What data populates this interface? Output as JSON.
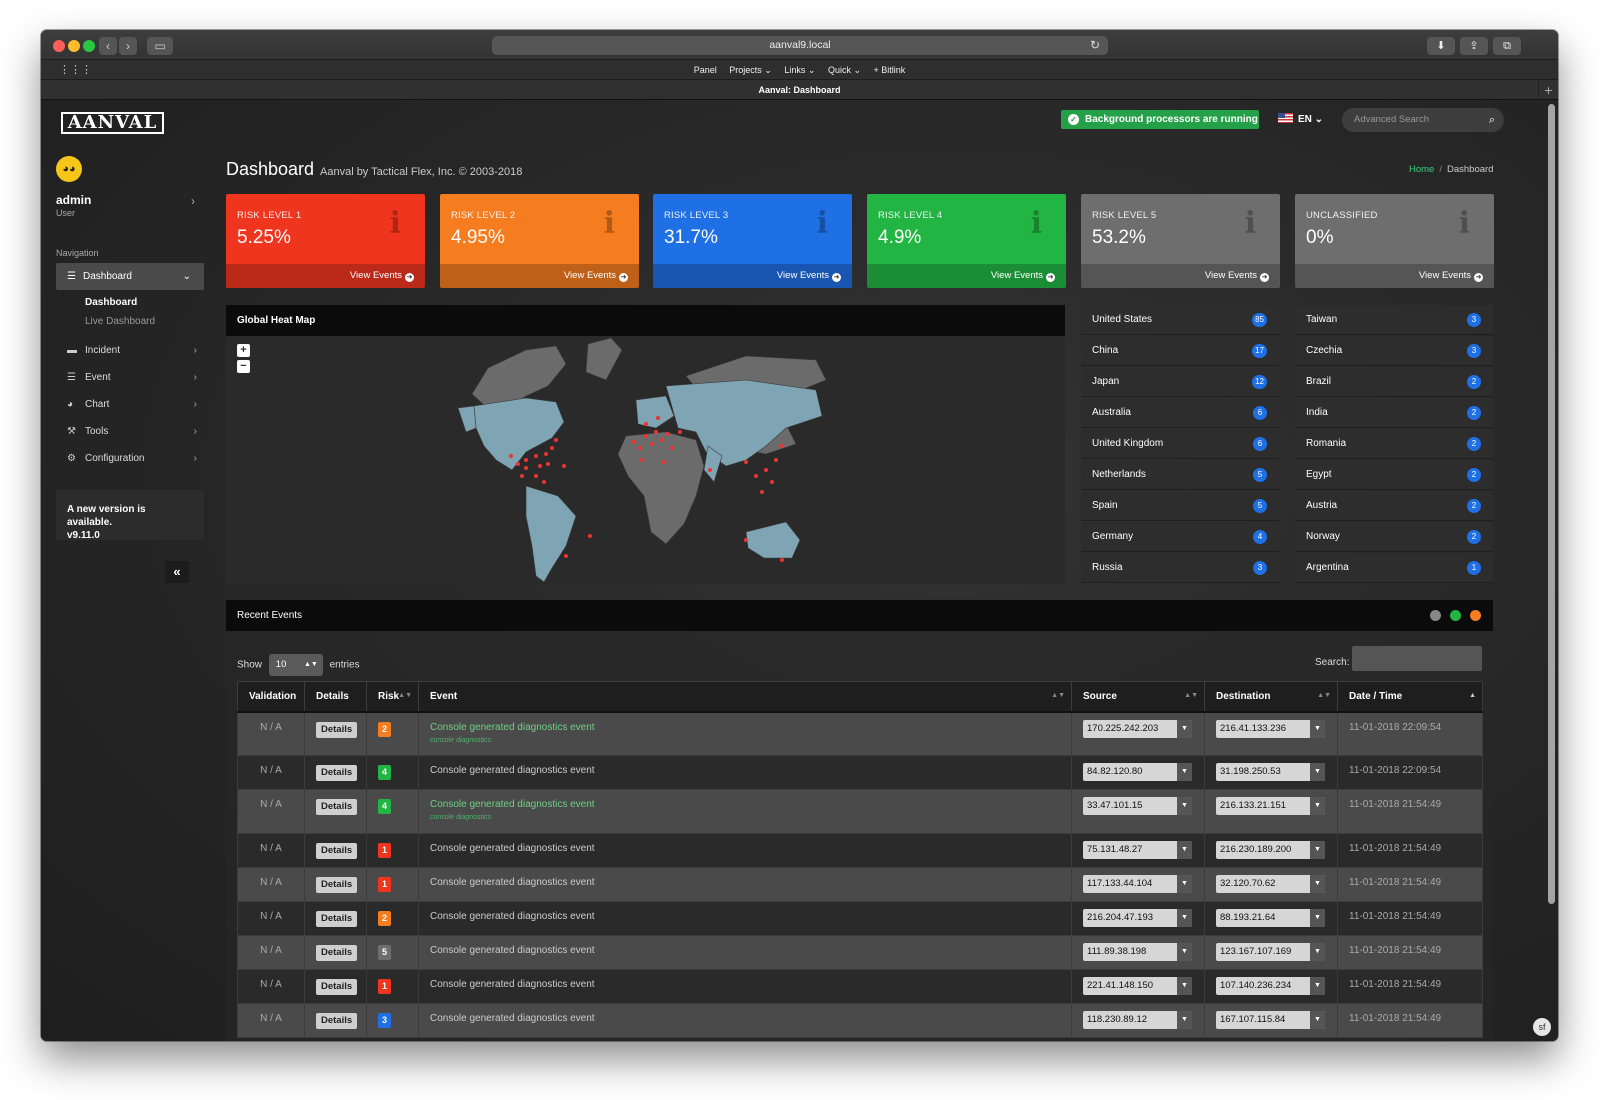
{
  "browser": {
    "url": "aanval9.local",
    "tab_title": "Aanval: Dashboard",
    "favorites": [
      "Panel",
      "Projects ⌄",
      "Links ⌄",
      "Quick ⌄",
      "+ Bitlink"
    ]
  },
  "brand": {
    "logo_text": "AANVAL"
  },
  "user": {
    "name": "admin",
    "role": "User"
  },
  "nav": {
    "label": "Navigation",
    "active": "Dashboard",
    "sub_items": [
      "Dashboard",
      "Live Dashboard"
    ],
    "items": [
      {
        "label": "Incident",
        "icon": "folder-icon"
      },
      {
        "label": "Event",
        "icon": "list-icon"
      },
      {
        "label": "Chart",
        "icon": "pie-chart-icon"
      },
      {
        "label": "Tools",
        "icon": "wrench-icon"
      },
      {
        "label": "Configuration",
        "icon": "cogs-icon"
      }
    ]
  },
  "version_notice": {
    "line1": "A new version is available.",
    "line2": "v9.11.0"
  },
  "topbar": {
    "status": "Background processors are running",
    "language": "EN",
    "search_placeholder": "Advanced Search"
  },
  "page": {
    "title": "Dashboard",
    "subtitle": "Aanval by Tactical Flex, Inc. © 2003-2018",
    "breadcrumb_home": "Home",
    "breadcrumb_current": "Dashboard"
  },
  "risk_cards": [
    {
      "label": "RISK LEVEL 1",
      "value": "5.25%",
      "color": "#f0351f",
      "link": "View Events"
    },
    {
      "label": "RISK LEVEL 2",
      "value": "4.95%",
      "color": "#f57c1f",
      "link": "View Events"
    },
    {
      "label": "RISK LEVEL 3",
      "value": "31.7%",
      "color": "#1f6fe5",
      "link": "View Events"
    },
    {
      "label": "RISK LEVEL 4",
      "value": "4.9%",
      "color": "#23b543",
      "link": "View Events"
    },
    {
      "label": "RISK LEVEL 5",
      "value": "53.2%",
      "color": "#6e6e6e",
      "link": "View Events"
    },
    {
      "label": "UNCLASSIFIED",
      "value": "0%",
      "color": "#6e6e6e",
      "link": "View Events"
    }
  ],
  "heatmap": {
    "title": "Global Heat Map"
  },
  "countries_left": [
    {
      "name": "United States",
      "count": "85"
    },
    {
      "name": "China",
      "count": "17"
    },
    {
      "name": "Japan",
      "count": "12"
    },
    {
      "name": "Australia",
      "count": "6"
    },
    {
      "name": "United Kingdom",
      "count": "6"
    },
    {
      "name": "Netherlands",
      "count": "5"
    },
    {
      "name": "Spain",
      "count": "5"
    },
    {
      "name": "Germany",
      "count": "4"
    },
    {
      "name": "Russia",
      "count": "3"
    }
  ],
  "countries_right": [
    {
      "name": "Taiwan",
      "count": "3"
    },
    {
      "name": "Czechia",
      "count": "3"
    },
    {
      "name": "Brazil",
      "count": "2"
    },
    {
      "name": "India",
      "count": "2"
    },
    {
      "name": "Romania",
      "count": "2"
    },
    {
      "name": "Egypt",
      "count": "2"
    },
    {
      "name": "Austria",
      "count": "2"
    },
    {
      "name": "Norway",
      "count": "2"
    },
    {
      "name": "Argentina",
      "count": "1"
    }
  ],
  "events": {
    "title": "Recent Events",
    "show_label": "Show",
    "entries_value": "10",
    "entries_label": "entries",
    "search_label": "Search:",
    "columns": [
      "Validation",
      "Details",
      "Risk",
      "Event",
      "Source",
      "Destination",
      "Date / Time"
    ],
    "details_label": "Details",
    "rows": [
      {
        "validation": "N / A",
        "risk": "2",
        "risk_color": "#f57c1f",
        "event": "Console generated diagnostics event",
        "sub": "console diagnostics",
        "source": "170.225.242.203",
        "dest": "216.41.133.236",
        "datetime": "11-01-2018 22:09:54"
      },
      {
        "validation": "N / A",
        "risk": "4",
        "risk_color": "#23b543",
        "event": "Console generated diagnostics event",
        "sub": "",
        "source": "84.82.120.80",
        "dest": "31.198.250.53",
        "datetime": "11-01-2018 22:09:54"
      },
      {
        "validation": "N / A",
        "risk": "4",
        "risk_color": "#23b543",
        "event": "Console generated diagnostics event",
        "sub": "console diagnostics",
        "source": "33.47.101.15",
        "dest": "216.133.21.151",
        "datetime": "11-01-2018 21:54:49"
      },
      {
        "validation": "N / A",
        "risk": "1",
        "risk_color": "#f0351f",
        "event": "Console generated diagnostics event",
        "sub": "",
        "source": "75.131.48.27",
        "dest": "216.230.189.200",
        "datetime": "11-01-2018 21:54:49"
      },
      {
        "validation": "N / A",
        "risk": "1",
        "risk_color": "#f0351f",
        "event": "Console generated diagnostics event",
        "sub": "",
        "source": "117.133.44.104",
        "dest": "32.120.70.62",
        "datetime": "11-01-2018 21:54:49"
      },
      {
        "validation": "N / A",
        "risk": "2",
        "risk_color": "#f57c1f",
        "event": "Console generated diagnostics event",
        "sub": "",
        "source": "216.204.47.193",
        "dest": "88.193.21.64",
        "datetime": "11-01-2018 21:54:49"
      },
      {
        "validation": "N / A",
        "risk": "5",
        "risk_color": "#6e6e6e",
        "event": "Console generated diagnostics event",
        "sub": "",
        "source": "111.89.38.198",
        "dest": "123.167.107.169",
        "datetime": "11-01-2018 21:54:49"
      },
      {
        "validation": "N / A",
        "risk": "1",
        "risk_color": "#f0351f",
        "event": "Console generated diagnostics event",
        "sub": "",
        "source": "221.41.148.150",
        "dest": "107.140.236.234",
        "datetime": "11-01-2018 21:54:49"
      },
      {
        "validation": "N / A",
        "risk": "3",
        "risk_color": "#1f6fe5",
        "event": "Console generated diagnostics event",
        "sub": "",
        "source": "118.230.89.12",
        "dest": "167.107.115.84",
        "datetime": "11-01-2018 21:54:49"
      }
    ]
  }
}
